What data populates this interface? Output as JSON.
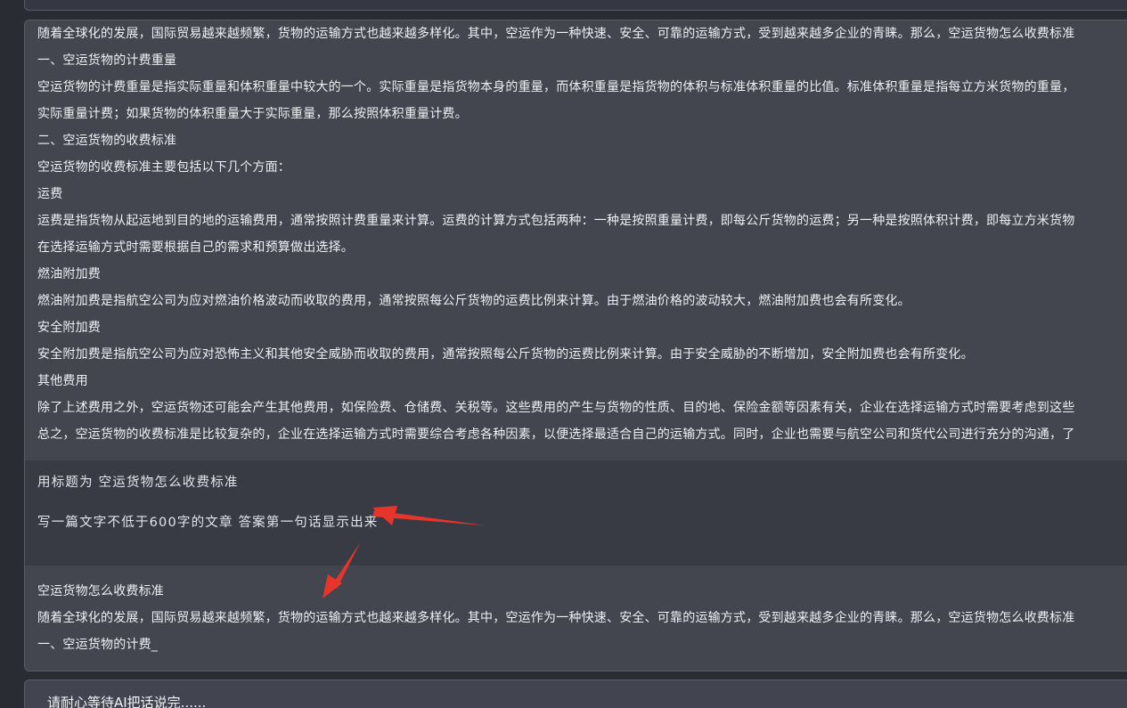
{
  "conversation": {
    "ai_response_1": [
      "随着全球化的发展，国际贸易越来越频繁，货物的运输方式也越来越多样化。其中，空运作为一种快速、安全、可靠的运输方式，受到越来越多企业的青睐。那么，空运货物怎么收费标准",
      "一、空运货物的计费重量",
      "空运货物的计费重量是指实际重量和体积重量中较大的一个。实际重量是指货物本身的重量，而体积重量是指货物的体积与标准体积重量的比值。标准体积重量是指每立方米货物的重量，",
      "实际重量计费；如果货物的体积重量大于实际重量，那么按照体积重量计费。",
      "二、空运货物的收费标准",
      "空运货物的收费标准主要包括以下几个方面：",
      "运费",
      "运费是指货物从起运地到目的地的运输费用，通常按照计费重量来计算。运费的计算方式包括两种：一种是按照重量计费，即每公斤货物的运费；另一种是按照体积计费，即每立方米货物",
      "在选择运输方式时需要根据自己的需求和预算做出选择。",
      "燃油附加费",
      "燃油附加费是指航空公司为应对燃油价格波动而收取的费用，通常按照每公斤货物的运费比例来计算。由于燃油价格的波动较大，燃油附加费也会有所变化。",
      "安全附加费",
      "安全附加费是指航空公司为应对恐怖主义和其他安全威胁而收取的费用，通常按照每公斤货物的运费比例来计算。由于安全威胁的不断增加，安全附加费也会有所变化。",
      "其他费用",
      "除了上述费用之外，空运货物还可能会产生其他费用，如保险费、仓储费、关税等。这些费用的产生与货物的性质、目的地、保险金额等因素有关，企业在选择运输方式时需要考虑到这些",
      "总之，空运货物的收费标准是比较复杂的，企业在选择运输方式时需要综合考虑各种因素，以便选择最适合自己的运输方式。同时，企业也需要与航空公司和货代公司进行充分的沟通，了"
    ],
    "user_prompt": [
      "用标题为   空运货物怎么收费标准",
      "写一篇文字不低于600字的文章  答案第一句话显示出来"
    ],
    "ai_response_2": [
      "空运货物怎么收费标准",
      "随着全球化的发展，国际贸易越来越频繁，货物的运输方式也越来越多样化。其中，空运作为一种快速、安全、可靠的运输方式，受到越来越多企业的青睐。那么，空运货物怎么收费标准",
      "一、空运货物的计费_"
    ]
  },
  "status": {
    "waiting_text": "请耐心等待AI把话说完......"
  },
  "annotations": {
    "arrow_color": "#e8352c"
  }
}
